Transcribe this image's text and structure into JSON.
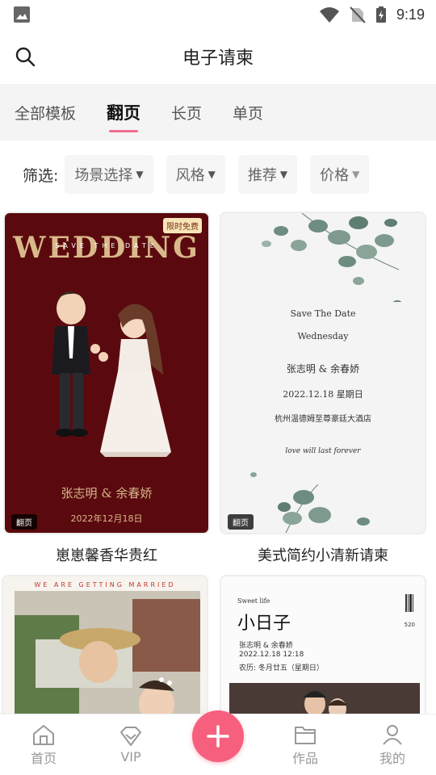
{
  "status_bar": {
    "time": "9:19"
  },
  "header": {
    "title": "电子请柬"
  },
  "tabs": [
    {
      "label": "全部模板",
      "active": false
    },
    {
      "label": "翻页",
      "active": true
    },
    {
      "label": "长页",
      "active": false
    },
    {
      "label": "单页",
      "active": false
    }
  ],
  "filters": {
    "label": "筛选:",
    "chips": [
      "场景选择",
      "风格",
      "推荐",
      "价格"
    ]
  },
  "cards": [
    {
      "name": "崽崽馨香华贵红",
      "badge": "翻页",
      "free_tag": "限时免费",
      "title": "WEDDING",
      "subtitle": "SAVE THE DATE",
      "couple": "张志明   &   余春娇",
      "date": "2022年12月18日"
    },
    {
      "name": "美式简约小清新请柬",
      "badge": "翻页",
      "lines": [
        "Save The Date",
        "Wednesday",
        "张志明  &  余春娇",
        "2022.12.18  星期日",
        "杭州温德姆至尊豪廷大酒店",
        "love will last forever"
      ]
    },
    {
      "name": "",
      "header_text": "WE ARE GETTING MARRIED"
    },
    {
      "name": "",
      "small": "Sweet life",
      "big": "小日子",
      "detail": [
        "张志明 & 余春娇",
        "2022.12.18  12:18",
        "农历: 冬月廿五（星期日）"
      ],
      "code": "520"
    }
  ],
  "bottom_nav": {
    "items": [
      {
        "label": "首页",
        "icon": "home-icon"
      },
      {
        "label": "VIP",
        "icon": "vip-diamond-icon"
      },
      {
        "label": "作品",
        "icon": "folder-icon"
      },
      {
        "label": "我的",
        "icon": "profile-icon"
      }
    ]
  },
  "colors": {
    "accent": "#f06f8e",
    "fab": "#f6607e",
    "card1_bg": "#5a0a0e",
    "gold": "#d9b98a"
  }
}
